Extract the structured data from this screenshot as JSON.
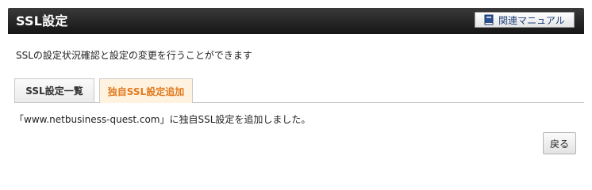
{
  "header": {
    "title": "SSL設定",
    "manual_button": {
      "label": "関連マニュアル",
      "icon": "book-icon"
    }
  },
  "description": "SSLの設定状況確認と設定の変更を行うことができます",
  "tabs": [
    {
      "label": "SSL設定一覧",
      "active": false
    },
    {
      "label": "独自SSL設定追加",
      "active": true
    }
  ],
  "message": "「www.netbusiness-quest.com」に独自SSL設定を追加しました。",
  "back_button": {
    "label": "戻る"
  },
  "colors": {
    "header_bg": "#1c1c1c",
    "active_tab_text": "#e07a1f",
    "active_tab_bg": "#fff3e0",
    "manual_link": "#1f3f7a"
  }
}
